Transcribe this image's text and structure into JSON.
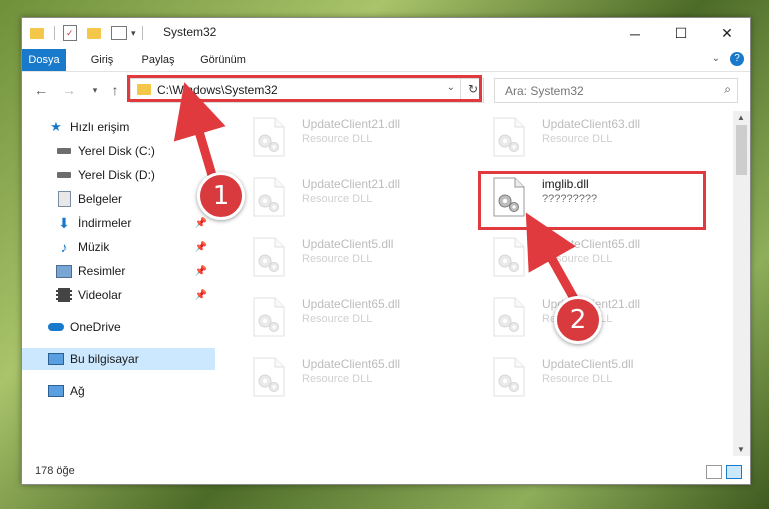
{
  "window": {
    "title": "System32"
  },
  "controls": {
    "minimize": "─",
    "maximize": "☐",
    "close": "✕"
  },
  "ribbon": {
    "tabs": [
      "Dosya",
      "Giriş",
      "Paylaş",
      "Görünüm"
    ]
  },
  "address": {
    "path": "C:\\Windows\\System32"
  },
  "search": {
    "placeholder": "Ara: System32"
  },
  "sidebar": {
    "items": [
      {
        "label": "Hızlı erişim"
      },
      {
        "label": "Yerel Disk (C:)"
      },
      {
        "label": "Yerel Disk (D:)"
      },
      {
        "label": "Belgeler"
      },
      {
        "label": "İndirmeler"
      },
      {
        "label": "Müzik"
      },
      {
        "label": "Resimler"
      },
      {
        "label": "Videolar"
      },
      {
        "label": "OneDrive"
      },
      {
        "label": "Bu bilgisayar"
      },
      {
        "label": "Ağ"
      }
    ]
  },
  "files": [
    {
      "name": "UpdateClient21.dll",
      "desc": "Resource DLL"
    },
    {
      "name": "UpdateClient63.dll",
      "desc": "Resource DLL"
    },
    {
      "name": "UpdateClient21.dll",
      "desc": "Resource DLL"
    },
    {
      "name": "imglib.dll",
      "desc": "?????????"
    },
    {
      "name": "UpdateClient5.dll",
      "desc": "Resource DLL"
    },
    {
      "name": "UpdateClient65.dll",
      "desc": "Resource DLL"
    },
    {
      "name": "UpdateClient65.dll",
      "desc": "Resource DLL"
    },
    {
      "name": "UpdateClient21.dll",
      "desc": "Resource DLL"
    },
    {
      "name": "UpdateClient65.dll",
      "desc": "Resource DLL"
    },
    {
      "name": "UpdateClient5.dll",
      "desc": "Resource DLL"
    }
  ],
  "status": {
    "count": "178 öğe"
  },
  "annotations": {
    "step1": "1",
    "step2": "2",
    "color": "#e0393e"
  }
}
